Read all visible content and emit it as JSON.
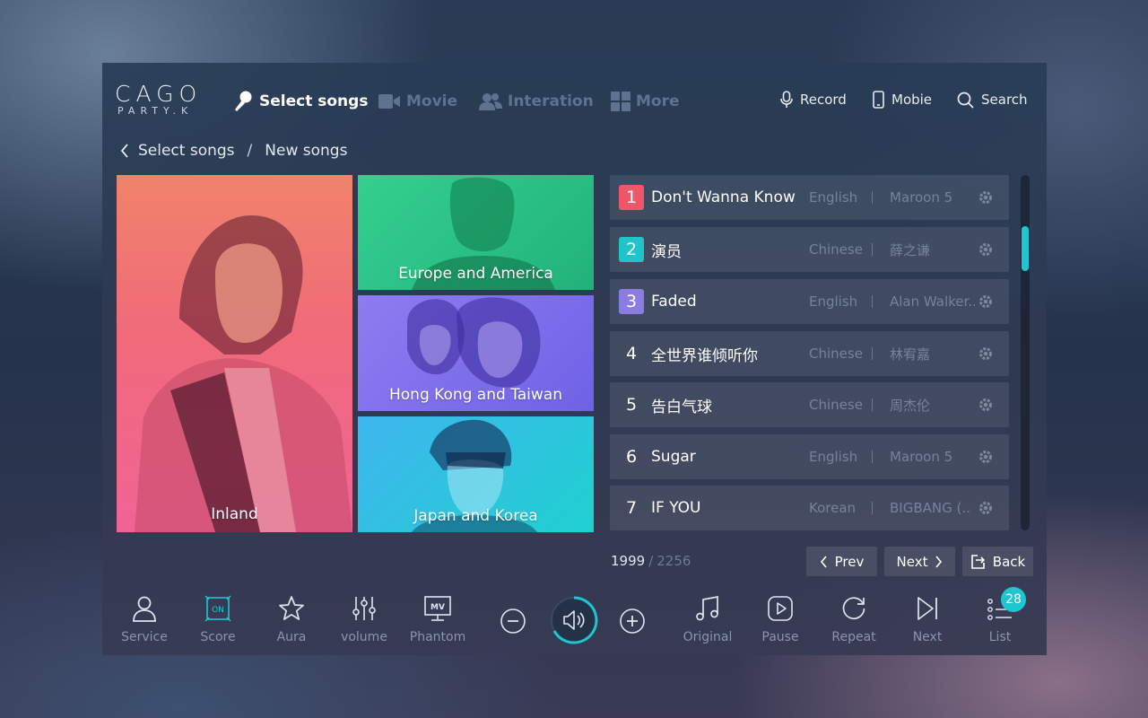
{
  "logo": {
    "main": "CAGO",
    "sub": "PARTY.K"
  },
  "nav": [
    {
      "label": "Select songs",
      "icon": "microphone-icon",
      "active": true
    },
    {
      "label": "Movie",
      "icon": "video-camera-icon",
      "active": false
    },
    {
      "label": "Interation",
      "icon": "users-icon",
      "active": false
    },
    {
      "label": "More",
      "icon": "grid-icon",
      "active": false
    }
  ],
  "tools": [
    {
      "label": "Record",
      "icon": "microphone-outline-icon"
    },
    {
      "label": "Mobie",
      "icon": "mobile-phone-icon"
    },
    {
      "label": "Search",
      "icon": "search-icon"
    }
  ],
  "breadcrumb": {
    "parent": "Select songs",
    "separator": "/",
    "current": "New songs"
  },
  "categories": [
    {
      "label": "Inland"
    },
    {
      "label": "Europe and America"
    },
    {
      "label": "Hong Kong and Taiwan"
    },
    {
      "label": "Japan and Korea"
    }
  ],
  "songs": [
    {
      "rank": "1",
      "title": "Don't Wanna Know",
      "language": "English",
      "artist": "Maroon 5",
      "rank_color": "#f0566a"
    },
    {
      "rank": "2",
      "title": "演员",
      "language": "Chinese",
      "artist": "薛之谦",
      "rank_color": "#1fc3c8"
    },
    {
      "rank": "3",
      "title": "Faded",
      "language": "English",
      "artist": "Alan Walker..",
      "rank_color": "#8a7ce0"
    },
    {
      "rank": "4",
      "title": "全世界谁倾听你",
      "language": "Chinese",
      "artist": "林宥嘉",
      "rank_color": ""
    },
    {
      "rank": "5",
      "title": "告白气球",
      "language": "Chinese",
      "artist": "周杰伦",
      "rank_color": ""
    },
    {
      "rank": "6",
      "title": "Sugar",
      "language": "English",
      "artist": "Maroon 5",
      "rank_color": ""
    },
    {
      "rank": "7",
      "title": "IF YOU",
      "language": "Korean",
      "artist": "BIGBANG (..",
      "rank_color": ""
    }
  ],
  "pager": {
    "current": "1999",
    "separator": "/",
    "total": "2256",
    "prev": "Prev",
    "next": "Next",
    "back": "Back"
  },
  "controls": {
    "service": "Service",
    "score": "Score",
    "score_badge": "ON",
    "aura": "Aura",
    "volume": "volume",
    "phantom": "Phantom",
    "phantom_badge": "MV",
    "original": "Original",
    "pause": "Pause",
    "repeat": "Repeat",
    "next": "Next",
    "list": "List",
    "list_count": "28"
  },
  "colors": {
    "accent": "#1ec6cf"
  }
}
